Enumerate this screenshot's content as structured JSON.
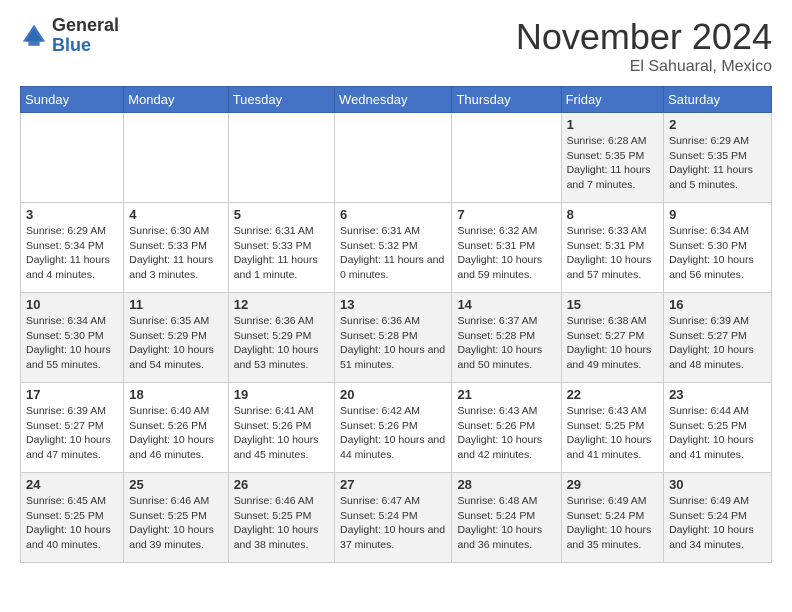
{
  "logo": {
    "general": "General",
    "blue": "Blue"
  },
  "title": "November 2024",
  "location": "El Sahuaral, Mexico",
  "days_of_week": [
    "Sunday",
    "Monday",
    "Tuesday",
    "Wednesday",
    "Thursday",
    "Friday",
    "Saturday"
  ],
  "weeks": [
    [
      {
        "day": "",
        "info": ""
      },
      {
        "day": "",
        "info": ""
      },
      {
        "day": "",
        "info": ""
      },
      {
        "day": "",
        "info": ""
      },
      {
        "day": "",
        "info": ""
      },
      {
        "day": "1",
        "info": "Sunrise: 6:28 AM\nSunset: 5:35 PM\nDaylight: 11 hours and 7 minutes."
      },
      {
        "day": "2",
        "info": "Sunrise: 6:29 AM\nSunset: 5:35 PM\nDaylight: 11 hours and 5 minutes."
      }
    ],
    [
      {
        "day": "3",
        "info": "Sunrise: 6:29 AM\nSunset: 5:34 PM\nDaylight: 11 hours and 4 minutes."
      },
      {
        "day": "4",
        "info": "Sunrise: 6:30 AM\nSunset: 5:33 PM\nDaylight: 11 hours and 3 minutes."
      },
      {
        "day": "5",
        "info": "Sunrise: 6:31 AM\nSunset: 5:33 PM\nDaylight: 11 hours and 1 minute."
      },
      {
        "day": "6",
        "info": "Sunrise: 6:31 AM\nSunset: 5:32 PM\nDaylight: 11 hours and 0 minutes."
      },
      {
        "day": "7",
        "info": "Sunrise: 6:32 AM\nSunset: 5:31 PM\nDaylight: 10 hours and 59 minutes."
      },
      {
        "day": "8",
        "info": "Sunrise: 6:33 AM\nSunset: 5:31 PM\nDaylight: 10 hours and 57 minutes."
      },
      {
        "day": "9",
        "info": "Sunrise: 6:34 AM\nSunset: 5:30 PM\nDaylight: 10 hours and 56 minutes."
      }
    ],
    [
      {
        "day": "10",
        "info": "Sunrise: 6:34 AM\nSunset: 5:30 PM\nDaylight: 10 hours and 55 minutes."
      },
      {
        "day": "11",
        "info": "Sunrise: 6:35 AM\nSunset: 5:29 PM\nDaylight: 10 hours and 54 minutes."
      },
      {
        "day": "12",
        "info": "Sunrise: 6:36 AM\nSunset: 5:29 PM\nDaylight: 10 hours and 53 minutes."
      },
      {
        "day": "13",
        "info": "Sunrise: 6:36 AM\nSunset: 5:28 PM\nDaylight: 10 hours and 51 minutes."
      },
      {
        "day": "14",
        "info": "Sunrise: 6:37 AM\nSunset: 5:28 PM\nDaylight: 10 hours and 50 minutes."
      },
      {
        "day": "15",
        "info": "Sunrise: 6:38 AM\nSunset: 5:27 PM\nDaylight: 10 hours and 49 minutes."
      },
      {
        "day": "16",
        "info": "Sunrise: 6:39 AM\nSunset: 5:27 PM\nDaylight: 10 hours and 48 minutes."
      }
    ],
    [
      {
        "day": "17",
        "info": "Sunrise: 6:39 AM\nSunset: 5:27 PM\nDaylight: 10 hours and 47 minutes."
      },
      {
        "day": "18",
        "info": "Sunrise: 6:40 AM\nSunset: 5:26 PM\nDaylight: 10 hours and 46 minutes."
      },
      {
        "day": "19",
        "info": "Sunrise: 6:41 AM\nSunset: 5:26 PM\nDaylight: 10 hours and 45 minutes."
      },
      {
        "day": "20",
        "info": "Sunrise: 6:42 AM\nSunset: 5:26 PM\nDaylight: 10 hours and 44 minutes."
      },
      {
        "day": "21",
        "info": "Sunrise: 6:43 AM\nSunset: 5:26 PM\nDaylight: 10 hours and 42 minutes."
      },
      {
        "day": "22",
        "info": "Sunrise: 6:43 AM\nSunset: 5:25 PM\nDaylight: 10 hours and 41 minutes."
      },
      {
        "day": "23",
        "info": "Sunrise: 6:44 AM\nSunset: 5:25 PM\nDaylight: 10 hours and 41 minutes."
      }
    ],
    [
      {
        "day": "24",
        "info": "Sunrise: 6:45 AM\nSunset: 5:25 PM\nDaylight: 10 hours and 40 minutes."
      },
      {
        "day": "25",
        "info": "Sunrise: 6:46 AM\nSunset: 5:25 PM\nDaylight: 10 hours and 39 minutes."
      },
      {
        "day": "26",
        "info": "Sunrise: 6:46 AM\nSunset: 5:25 PM\nDaylight: 10 hours and 38 minutes."
      },
      {
        "day": "27",
        "info": "Sunrise: 6:47 AM\nSunset: 5:24 PM\nDaylight: 10 hours and 37 minutes."
      },
      {
        "day": "28",
        "info": "Sunrise: 6:48 AM\nSunset: 5:24 PM\nDaylight: 10 hours and 36 minutes."
      },
      {
        "day": "29",
        "info": "Sunrise: 6:49 AM\nSunset: 5:24 PM\nDaylight: 10 hours and 35 minutes."
      },
      {
        "day": "30",
        "info": "Sunrise: 6:49 AM\nSunset: 5:24 PM\nDaylight: 10 hours and 34 minutes."
      }
    ]
  ]
}
